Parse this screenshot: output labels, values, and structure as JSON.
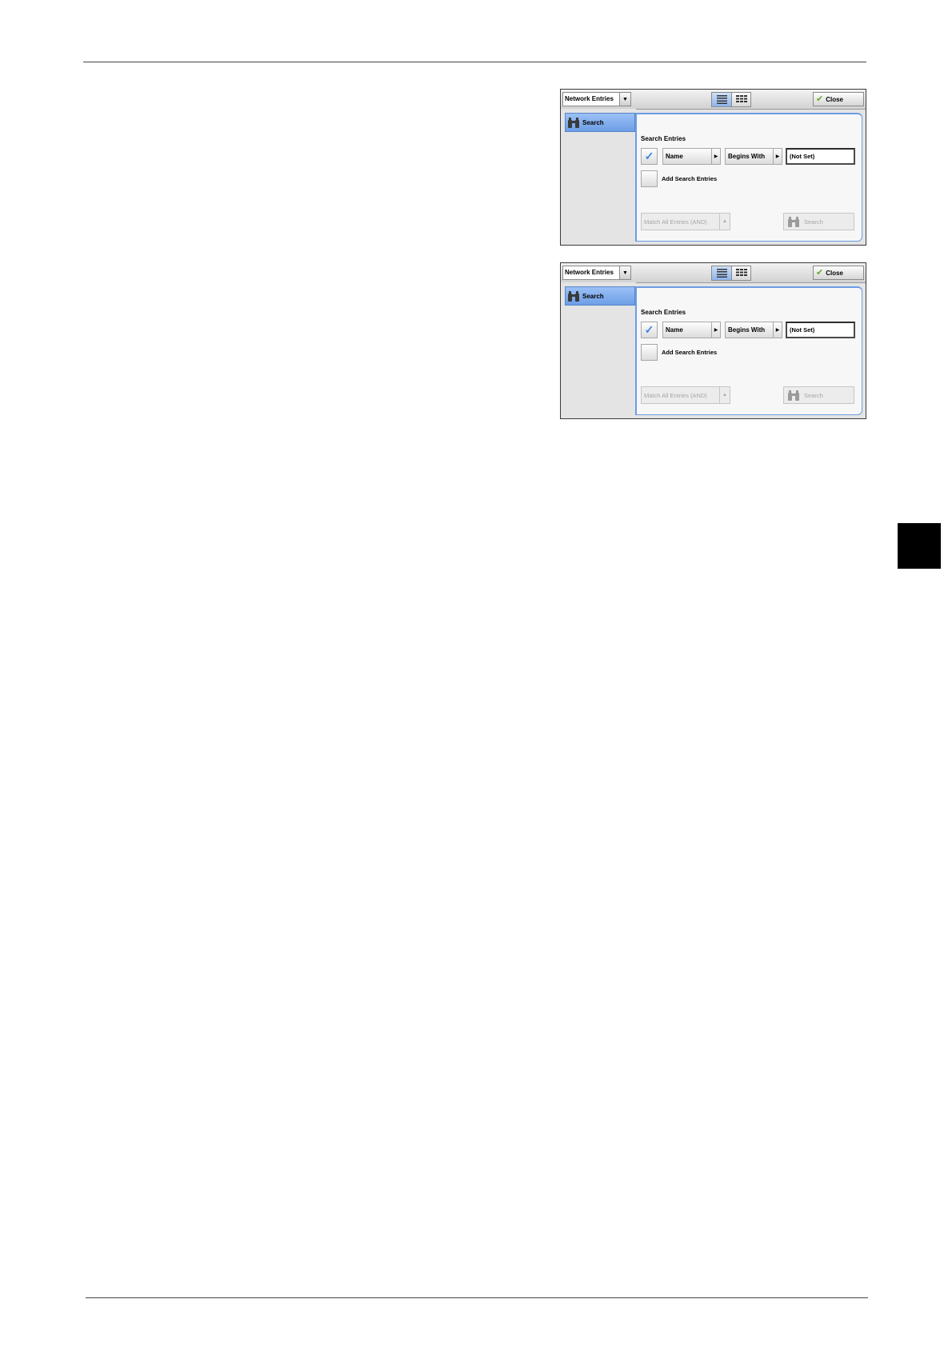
{
  "panels": [
    {
      "network_dropdown": "Network Entries",
      "close_label": "Close",
      "sidebar_item": "Search",
      "search_entries_title": "Search Entries",
      "field_name": "Name",
      "field_condition": "Begins With",
      "field_value": "(Not Set)",
      "add_search_entries": "Add Search Entries",
      "match_all": "Match All Entries (AND)",
      "search_button": "Search",
      "first_entry_checked": true
    },
    {
      "network_dropdown": "Network Entries",
      "close_label": "Close",
      "sidebar_item": "Search",
      "search_entries_title": "Search Entries",
      "field_name": "Name",
      "field_condition": "Begins With",
      "field_value": "(Not Set)",
      "add_search_entries": "Add Search Entries",
      "match_all": "Match All Entries (AND)",
      "search_button": "Search",
      "first_entry_checked": true
    }
  ],
  "icons": {
    "dropdown": "chevron-down-icon",
    "list_view": "list-view-icon",
    "thumbnail_view": "thumbnail-view-icon",
    "close": "check-icon",
    "search": "binoculars-icon",
    "arrow_right": "arrow-right-icon",
    "arrow_up": "arrow-up-icon"
  },
  "colors": {
    "accent": "#6d9ee6",
    "check": "#3c86e0",
    "close_check": "#6aa82e",
    "chapter_tab": "#000000"
  }
}
